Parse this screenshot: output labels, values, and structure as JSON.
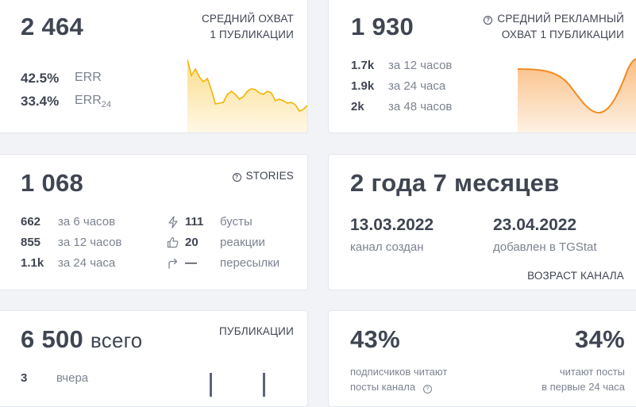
{
  "card_reach": {
    "value": "2 464",
    "caption_line1": "СРЕДНИЙ ОХВАТ",
    "caption_line2": "1 ПУБЛИКАЦИИ",
    "err_value": "42.5%",
    "err_label": "ERR",
    "err24_value": "33.4%",
    "err24_label": "ERR",
    "err24_sub": "24",
    "accent": "#f5b301"
  },
  "card_ad_reach": {
    "value": "1 930",
    "caption_line1": "СРЕДНИЙ РЕКЛАМНЫЙ",
    "caption_line2": "ОХВАТ 1 ПУБЛИКАЦИИ",
    "help_icon": "question-circle-icon",
    "rows": [
      {
        "value": "1.7k",
        "label": "за 12 часов"
      },
      {
        "value": "1.9k",
        "label": "за 24 часа"
      },
      {
        "value": "2k",
        "label": "за 48 часов"
      }
    ],
    "accent": "#f58a1f"
  },
  "card_stories": {
    "value": "1 068",
    "caption": "STORIES",
    "help_icon": "question-circle-icon",
    "rows": [
      {
        "value": "662",
        "label": "за 6 часов"
      },
      {
        "value": "855",
        "label": "за 12 часов"
      },
      {
        "value": "1.1k",
        "label": "за 24 часа"
      }
    ],
    "stats": [
      {
        "icon": "lightning-icon",
        "value": "111",
        "label": "бусты"
      },
      {
        "icon": "thumbs-up-icon",
        "value": "20",
        "label": "реакции"
      },
      {
        "icon": "share-arrow-icon",
        "value": "—",
        "label": "пересылки"
      }
    ]
  },
  "card_age": {
    "value": "2 года 7 месяцев",
    "created_date": "13.03.2022",
    "created_label": "канал создан",
    "added_date": "23.04.2022",
    "added_label": "добавлен в TGStat",
    "caption": "ВОЗРАСТ КАНАЛА"
  },
  "card_posts": {
    "value": "6 500",
    "value_suffix": "всего",
    "caption": "ПУБЛИКАЦИИ",
    "row_value": "3",
    "row_label": "вчера"
  },
  "card_readers": {
    "left_value": "43%",
    "left_line1": "подписчиков читают",
    "left_line2": "посты канала",
    "right_value": "34%",
    "right_line1": "читают посты",
    "right_line2": "в первые 24 часа",
    "help_icon": "question-circle-icon"
  }
}
